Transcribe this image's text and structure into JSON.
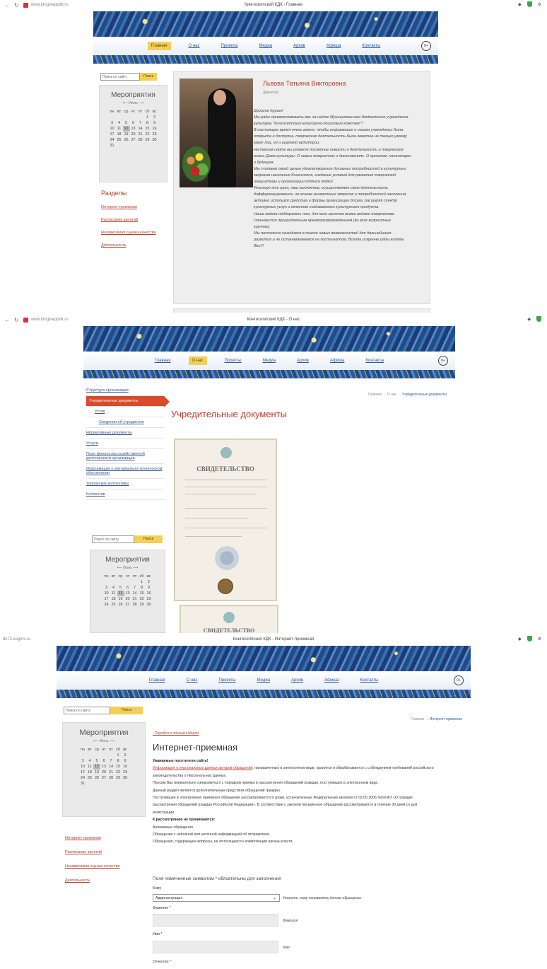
{
  "shot1": {
    "url": "www.kingiseppdk.ru",
    "tab_title": "Кингисеппский КДК - Главная",
    "menu": [
      "Главная",
      "О нас",
      "Проекты",
      "Медиа",
      "Архив",
      "Афиша",
      "Контакты"
    ],
    "age_badge": "0+",
    "search": {
      "placeholder": "Поиск по сайту",
      "button": "Поиск"
    },
    "calendar": {
      "title": "Мероприятия",
      "month": "Июль",
      "weekdays": [
        "пн",
        "вт",
        "ср",
        "чт",
        "пт",
        "сб",
        "вс"
      ],
      "rows": [
        [
          "",
          "",
          "",
          "",
          "",
          "1",
          "2"
        ],
        [
          "3",
          "4",
          "5",
          "6",
          "7",
          "8",
          "9"
        ],
        [
          "10",
          "11",
          "12",
          "13",
          "14",
          "15",
          "16"
        ],
        [
          "17",
          "18",
          "19",
          "20",
          "21",
          "22",
          "23"
        ],
        [
          "24",
          "25",
          "26",
          "27",
          "28",
          "29",
          "30"
        ],
        [
          "31",
          "",
          "",
          "",
          "",
          "",
          ""
        ]
      ],
      "today": "12"
    },
    "sections_title": "Разделы",
    "sections": [
      "Интернет-приемная",
      "Расписание занятий",
      "Независимая оценка качества",
      "Деятельность"
    ],
    "greeting": {
      "name": "Львова Татьяна Викторовна",
      "role": "Директор",
      "lines": [
        "Дорогие друзья!",
        "Мы рады приветствовать вас на сайте Муниципального бюджетного учреждения",
        "культуры \"Кингисеппский культурно-досуговый комплекс\"!",
        "В настоящее время очень важно, чтобы информация о нашем учреждении была",
        "открыта и доступна, творческая деятельность была заметна не только узкому",
        "кругу лиц, но и широкой аудитории.",
        "На данном сайте вы узнаете последние новости о деятельности и творческой",
        "жизни Дома культуры. О новых открытиях и достижениях. О прошлом, настоящем",
        "и будущем.",
        "Мы считаем своей целью удовлетворение духовных потребностей в культурных",
        "запросов населения Кингисеппа, создание условий для развития творческой",
        "инициативы и организации отдыха людей.",
        "Реализуя эти цели, наш коллектив, осуществляет свою деятельность",
        "дифференцированно, на основе конкретных запросов и потребностей населения,",
        "активно используя средства и формы организации досуга, расширяя спектр",
        "культурных услуг и качество создаваемого культурного продукта.",
        "Наша задача поддержать тех, для кого занятия всеми видами творчества",
        "становится приоритетным времяпрепровождением (во всех возрастных",
        "группах).",
        "Мы постоянно находимся в поиске новых возможностей для дальнейшего",
        "развития и не останавливаемся на достигнутом. Всегда искренне рады видеть",
        "Вас!!!"
      ]
    }
  },
  "shot2": {
    "url": "www.kingiseppdk.ru",
    "tab_title": "Кингисеппский КДК - О нас",
    "menu": [
      "Главная",
      "О нас",
      "Проекты",
      "Медиа",
      "Архив",
      "Афиша",
      "Контакты"
    ],
    "age_badge": "0+",
    "breadcrumb": {
      "home": "Главная",
      "sep": "→",
      "mid": "О нас",
      "current": "Учредительные документы"
    },
    "sidebar": [
      {
        "label": "Структура организации",
        "kind": "item"
      },
      {
        "label": "Учредительные документы",
        "kind": "active"
      },
      {
        "label": "Устав",
        "kind": "sub"
      },
      {
        "label": "Сведения об учредителе",
        "kind": "subsub"
      },
      {
        "label": "Нормативные документы",
        "kind": "item"
      },
      {
        "label": "Услуги",
        "kind": "item"
      },
      {
        "label": "План финансово-хозяйственной деятельности организации",
        "kind": "item"
      },
      {
        "label": "Информация о материально-техническом обеспечении",
        "kind": "item"
      },
      {
        "label": "Творческие коллективы",
        "kind": "item"
      },
      {
        "label": "Коллектив",
        "kind": "item"
      }
    ],
    "heading": "Учредительные документы",
    "doc_title": "СВИДЕТЕЛЬСТВО",
    "doc_title_2": "СВИДЕТЕЛЬСТВО",
    "search": {
      "placeholder": "Поиск по сайту",
      "button": "Поиск"
    },
    "calendar": {
      "title": "Мероприятия",
      "month": "Июль",
      "weekdays": [
        "пн",
        "вт",
        "ср",
        "чт",
        "пт",
        "сб",
        "вс"
      ],
      "rows": [
        [
          "",
          "",
          "",
          "",
          "",
          "1",
          "2"
        ],
        [
          "3",
          "4",
          "5",
          "6",
          "7",
          "8",
          "9"
        ],
        [
          "10",
          "11",
          "12",
          "13",
          "14",
          "15",
          "16"
        ],
        [
          "17",
          "18",
          "19",
          "20",
          "21",
          "22",
          "23"
        ],
        [
          "24",
          "25",
          "26",
          "27",
          "28",
          "29",
          "30"
        ]
      ],
      "today": "12"
    }
  },
  "shot3": {
    "url": "dk72.esgms.ru",
    "tab_title": "Кингисеппский КДК - Интернет-приемная",
    "menu": [
      "Главная",
      "О нас",
      "Проекты",
      "Медиа",
      "Архив",
      "Афиша",
      "Контакты"
    ],
    "age_badge": "0+",
    "search": {
      "placeholder": "Поиск по сайту",
      "button": "Поиск"
    },
    "calendar": {
      "title": "Мероприятия",
      "month": "Июль",
      "weekdays": [
        "пн",
        "вт",
        "ср",
        "чт",
        "пт",
        "сб",
        "вс"
      ],
      "rows": [
        [
          "",
          "",
          "",
          "",
          "",
          "1",
          "2"
        ],
        [
          "3",
          "4",
          "5",
          "6",
          "7",
          "8",
          "9"
        ],
        [
          "10",
          "11",
          "12",
          "13",
          "14",
          "15",
          "16"
        ],
        [
          "17",
          "18",
          "19",
          "20",
          "21",
          "22",
          "23"
        ],
        [
          "24",
          "25",
          "26",
          "27",
          "28",
          "29",
          "30"
        ],
        [
          "31",
          "",
          "",
          "",
          "",
          "",
          ""
        ]
      ],
      "today": "12"
    },
    "sections": [
      "Интернет-приемная",
      "Расписание занятий",
      "Независимая оценка качества",
      "Деятельность"
    ],
    "breadcrumb": {
      "home": "Главная",
      "sep": "→",
      "current": "Интернет-приемная"
    },
    "cabinet_link": "‹ Перейти в личный кабинет",
    "heading": "Интернет-приемная",
    "visitors": "Уважаемые посетители сайта!",
    "para1_link": "Информация о персональных данных авторов обращений",
    "para1_rest": ", направленных в электронном виде, хранится и обрабатывается с соблюдением требований российского",
    "para1_line2": "законодательства о персональных данных.",
    "para2": "Просим Вас внимательно ознакомиться с порядком приема и рассмотрения обращений граждан, поступивших в электронном виде.",
    "para3": "Данный раздел является дополнительным средством обращений граждан.",
    "para4": "Поступившее в электронную приемную обращение рассматривается в сроки, установленные Федеральным законом от 02.05.2006 №59-ФЗ «О порядке",
    "para4_line2": "рассмотрения обращений граждан Российской Федерации». В соответствии с законом письменное обращение рассматривается в течение 30 дней со дня",
    "para4_line3": "регистрации.",
    "not_accepted": "К рассмотрению не принимаются:",
    "rules": [
      "Анонимные обращения.",
      "Обращения с неполной или неточной информацией об отправителе.",
      "Обращения, содержащие вопросы, не относящиеся к компетенции органа власти."
    ],
    "form": {
      "required_note": "Поля помеченные символом * обязательны для заполнения",
      "to_label": "Кому",
      "to_value": "Администрация",
      "to_hint": "Укажите, кому направлять данное обращение.",
      "surname_label": "Фамилия *",
      "surname_hint": "Фамилия",
      "name_label": "Имя *",
      "name_hint": "Имя",
      "patronymic_label": "Отчество *"
    }
  }
}
